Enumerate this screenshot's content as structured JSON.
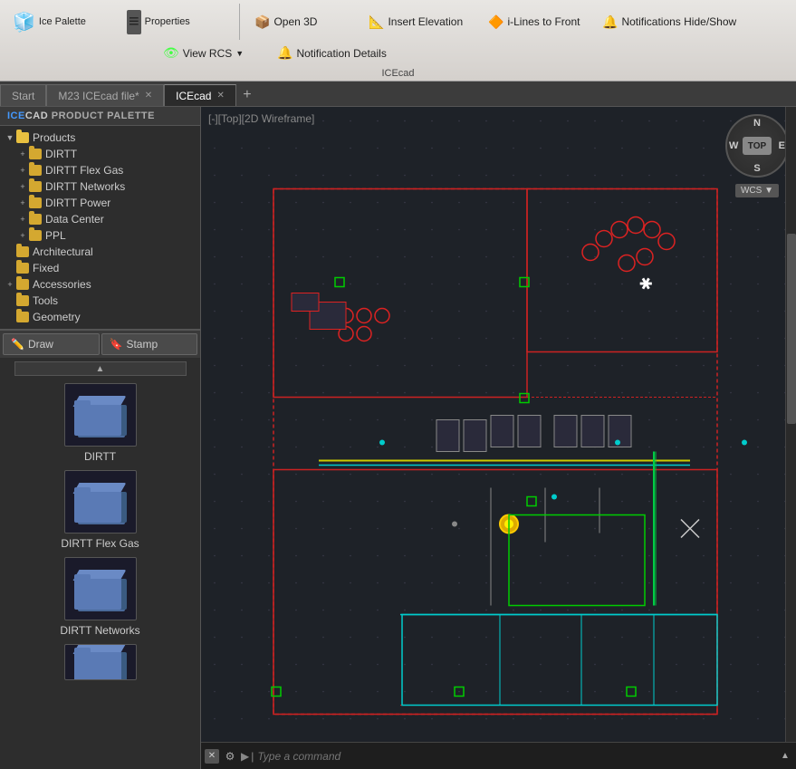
{
  "toolbar": {
    "app_name": "ICEcad",
    "buttons_left": [
      {
        "id": "open-3d",
        "label": "Open 3D",
        "icon": "open-3d-icon"
      },
      {
        "id": "insert-elevation",
        "label": "Insert Elevation",
        "icon": "insert-elevation-icon"
      },
      {
        "id": "i-lines-front",
        "label": "i-Lines to Front",
        "icon": "ilines-icon"
      },
      {
        "id": "notif-hide-show",
        "label": "Notifications Hide/Show",
        "icon": "notification-icon"
      },
      {
        "id": "view-rcs",
        "label": "View RCS",
        "icon": "view-rcs-icon"
      },
      {
        "id": "notif-details",
        "label": "Notification Details",
        "icon": "notif-details-icon"
      }
    ]
  },
  "tabs": [
    {
      "id": "start",
      "label": "Start",
      "closeable": false,
      "active": false
    },
    {
      "id": "m23",
      "label": "M23 ICEcad file*",
      "closeable": true,
      "active": false
    },
    {
      "id": "icecad",
      "label": "ICEcad",
      "closeable": true,
      "active": true
    }
  ],
  "left_panel": {
    "header": "ICECAD PRODUCT PALETTE",
    "tree": [
      {
        "id": "products",
        "label": "Products",
        "level": 0,
        "expanded": true,
        "has_children": true
      },
      {
        "id": "dirtt",
        "label": "DIRTT",
        "level": 1,
        "expanded": false,
        "has_children": true
      },
      {
        "id": "dirtt-flex-gas",
        "label": "DIRTT Flex Gas",
        "level": 1,
        "expanded": false,
        "has_children": true
      },
      {
        "id": "dirtt-networks",
        "label": "DIRTT Networks",
        "level": 1,
        "expanded": false,
        "has_children": true
      },
      {
        "id": "dirtt-power",
        "label": "DIRTT Power",
        "level": 1,
        "expanded": false,
        "has_children": true
      },
      {
        "id": "data-center",
        "label": "Data Center",
        "level": 1,
        "expanded": false,
        "has_children": true
      },
      {
        "id": "ppl",
        "label": "PPL",
        "level": 1,
        "expanded": false,
        "has_children": true
      },
      {
        "id": "architectural",
        "label": "Architectural",
        "level": 0,
        "expanded": false,
        "has_children": false
      },
      {
        "id": "fixed",
        "label": "Fixed",
        "level": 0,
        "expanded": false,
        "has_children": false
      },
      {
        "id": "accessories",
        "label": "Accessories",
        "level": 0,
        "expanded": false,
        "has_children": true
      },
      {
        "id": "tools",
        "label": "Tools",
        "level": 0,
        "expanded": false,
        "has_children": false
      },
      {
        "id": "geometry",
        "label": "Geometry",
        "level": 0,
        "expanded": false,
        "has_children": false
      }
    ],
    "draw_label": "Draw",
    "stamp_label": "Stamp",
    "thumbnails": [
      {
        "id": "dirtt-thumb",
        "label": "DIRTT"
      },
      {
        "id": "dirtt-flex-gas-thumb",
        "label": "DIRTT Flex Gas"
      },
      {
        "id": "dirtt-networks-thumb",
        "label": "DIRTT Networks"
      }
    ]
  },
  "viewport": {
    "label": "[-][Top][2D Wireframe]",
    "compass": {
      "n": "N",
      "s": "S",
      "e": "E",
      "w": "W",
      "top_label": "TOP",
      "wcs_label": "WCS ▼"
    }
  },
  "command_line": {
    "placeholder": "Type a command"
  }
}
